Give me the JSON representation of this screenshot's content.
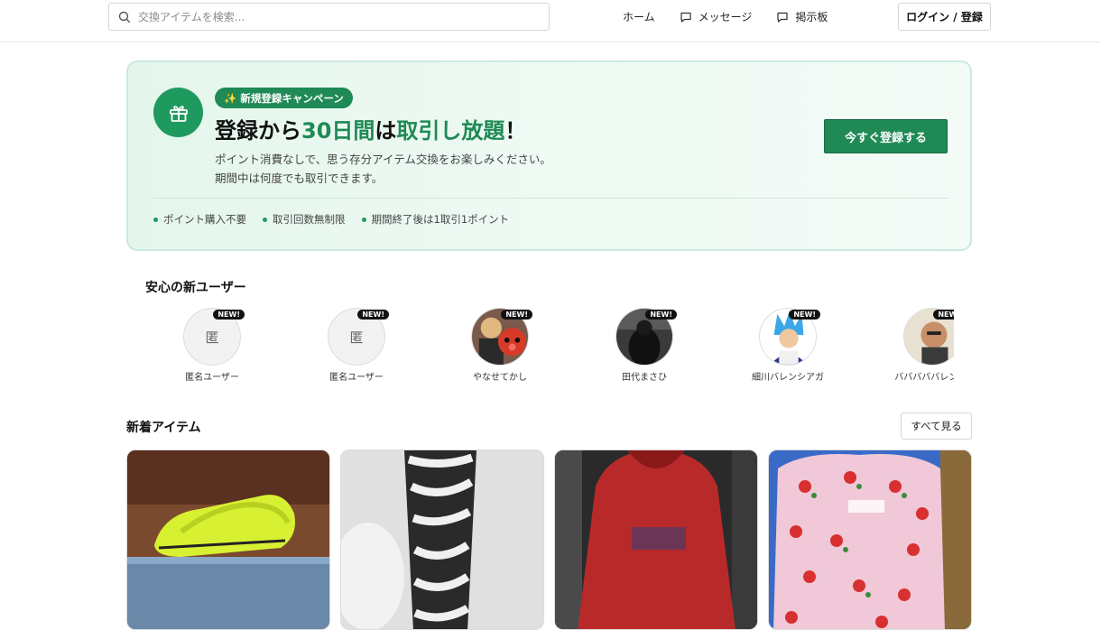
{
  "header": {
    "search_placeholder": "交換アイテムを検索...",
    "nav": [
      {
        "label": "ホーム",
        "icon": "none"
      },
      {
        "label": "メッセージ",
        "icon": "message-icon"
      },
      {
        "label": "掲示板",
        "icon": "board-icon"
      }
    ],
    "login_label": "ログイン / 登録"
  },
  "campaign": {
    "badge": "✨ 新規登録キャンペーン",
    "title_parts": [
      "登録から",
      "30日間",
      "は",
      "取引し放題",
      "！"
    ],
    "desc_lines": [
      "ポイント消費なしで、思う存分アイテム交換をお楽しみください。",
      "期間中は何度でも取引できます。"
    ],
    "cta_label": "今すぐ登録する",
    "features": [
      "ポイント購入不要",
      "取引回数無制限",
      "期間終了後は1取引1ポイント"
    ],
    "accent_color": "#1f8a55"
  },
  "new_users": {
    "title": "安心の新ユーザー",
    "badge": "NEW!",
    "users": [
      {
        "name": "匿名ユーザー",
        "avatar_text": "匿"
      },
      {
        "name": "匿名ユーザー",
        "avatar_text": "匿"
      },
      {
        "name": "やなせてかし",
        "avatar_text": ""
      },
      {
        "name": "田代まさひ",
        "avatar_text": ""
      },
      {
        "name": "細川バレンシアガ",
        "avatar_text": ""
      },
      {
        "name": "バババババレンス-",
        "avatar_text": ""
      }
    ]
  },
  "new_items": {
    "title": "新着アイテム",
    "see_all_label": "すべて見る",
    "items": [
      {
        "image": "yellow-sneakers"
      },
      {
        "image": "zebra-pants"
      },
      {
        "image": "red-hoodie"
      },
      {
        "image": "floral-sweater"
      }
    ]
  }
}
